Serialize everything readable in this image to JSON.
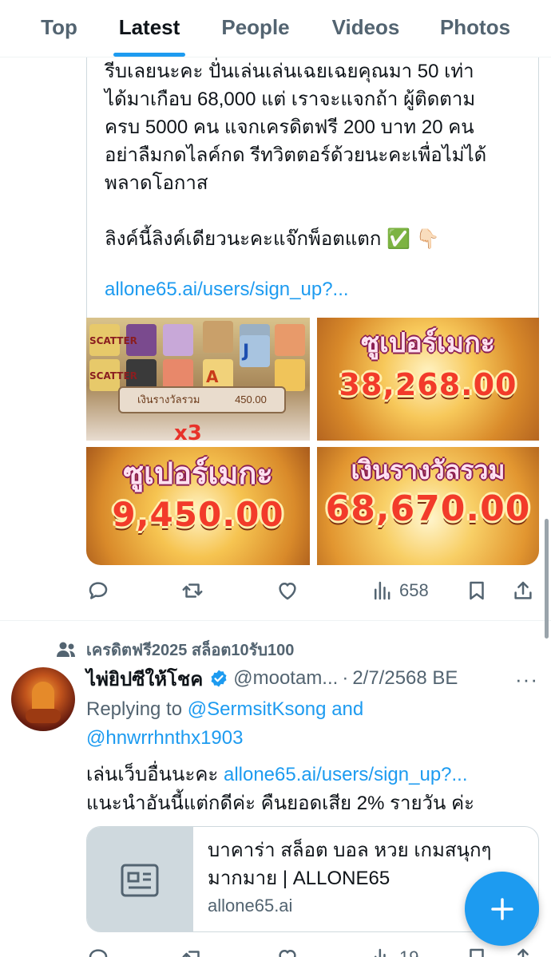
{
  "tabs": [
    {
      "label": "Top",
      "active": false
    },
    {
      "label": "Latest",
      "active": true
    },
    {
      "label": "People",
      "active": false
    },
    {
      "label": "Videos",
      "active": false
    },
    {
      "label": "Photos",
      "active": false
    }
  ],
  "tweet1": {
    "text_lines": [
      "รีบเลยนะคะ  ปั่นเล่นเล่นเฉยเฉยคุณมา 50 เท่า",
      "ได้มาเกือบ 68,000 แต่ เราจะแจกถ้า ผู้ติดตาม",
      "ครบ 5000 คน แจกเครดิตฟรี 200 บาท 20 คน",
      "อย่าลืมกดไลค์กด รีทวิตตอร์ด้วยนะคะเพื่อไม่ได้",
      "พลาดโอกาส",
      "",
      "ลิงค์นี้ลิงค์เดียวนะคะแจ๊กพ็อตแตก  ✅ 👇🏻"
    ],
    "link": "allone65.ai/users/sign_up?...",
    "images": {
      "img1": {
        "scatter": "SCATTER",
        "plaque": "เงินรางวัลรวม",
        "plaque_amount": "450.00",
        "multiplier": "x3"
      },
      "img2": {
        "title": "ซูเปอร์เมกะ",
        "amount": "38,268.00"
      },
      "img3": {
        "title": "ซูเปอร์เมกะ",
        "amount": "9,450.00"
      },
      "img4": {
        "title": "เงินรางวัลรวม",
        "amount": "68,670.00"
      }
    },
    "views": "658"
  },
  "tweet2": {
    "social_context": "เครดิตฟรี2025 สล็อต10รับ100",
    "name": "ไพ่ยิปซีให้โชค",
    "handle": "@mootam...",
    "separator": "·",
    "date": "2/7/2568 BE",
    "more": "···",
    "replying_prefix": "Replying to",
    "reply_user1": "@SermsitKsong",
    "reply_and": "and",
    "reply_user2": "@hnwrrhnthx1903",
    "text_line1_prefix": "เล่นเว็บอื่นนะคะ",
    "text_line1_link": "allone65.ai/users/sign_up?...",
    "text_line2": "แนะนำอันนี้แต่กดีค่ะ คืนยอดเสีย 2% รายวัน ค่ะ",
    "card": {
      "title": "บาคาร่า สล็อต บอล หวย เกมสนุกๆ มากมาย | ALLONE65",
      "domain": "allone65.ai"
    },
    "views": "19"
  },
  "colors": {
    "accent": "#1d9bf0",
    "text": "#0f1419",
    "secondary": "#536471",
    "border": "#cfd9de"
  },
  "icons": [
    "reply-icon",
    "retweet-icon",
    "like-icon",
    "views-icon",
    "bookmark-icon",
    "share-icon",
    "verified-badge-icon",
    "people-icon",
    "article-icon",
    "compose-plus-icon",
    "more-icon"
  ]
}
